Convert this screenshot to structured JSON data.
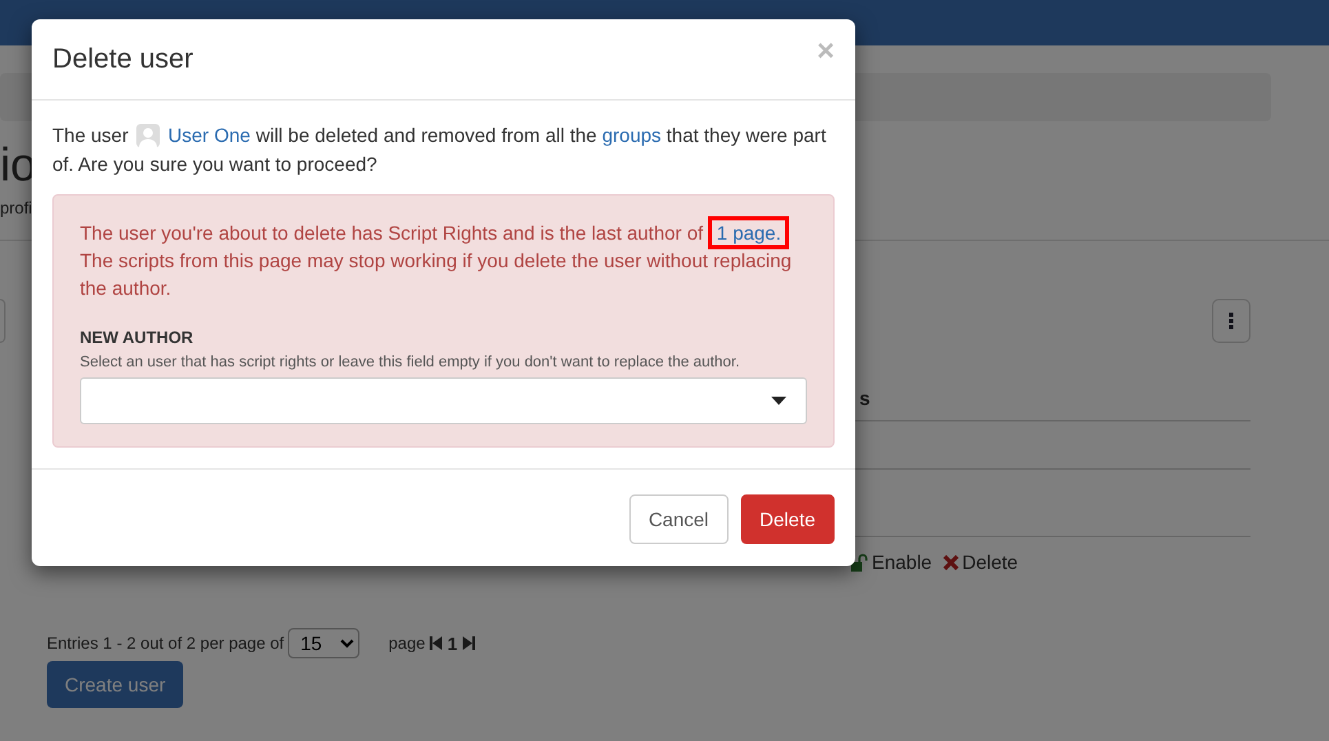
{
  "page": {
    "heading": "io",
    "subtitle": "profi",
    "column_header": "s",
    "row_actions": [
      {
        "kind": "enable",
        "label": "Enable"
      },
      {
        "kind": "delete",
        "label": "Delete"
      }
    ],
    "pagination": {
      "summary": "Entries 1 - 2 out of 2 per page of",
      "page_size": "15",
      "page_label": "page",
      "current_page": "1"
    },
    "create_button": "Create user"
  },
  "dialog": {
    "title": "Delete user",
    "close": "×",
    "message": {
      "before": "The user",
      "user": "User One",
      "middle": "will be deleted and removed from all the",
      "groups_link": "groups",
      "after": "that they were part of. Are you sure you want to proceed?"
    },
    "warning": {
      "before": "The user you're about to delete has Script Rights and is the last author of",
      "link": "1 page.",
      "link_highlighted": true,
      "after": "The scripts from this page may stop working if you delete the user without replacing the author."
    },
    "new_author": {
      "label": "NEW AUTHOR",
      "hint": "Select an user that has script rights or leave this field empty if you don't want to replace the author."
    },
    "buttons": [
      {
        "kind": "secondary",
        "label": "Cancel"
      },
      {
        "kind": "danger",
        "label": "Delete"
      }
    ]
  }
}
